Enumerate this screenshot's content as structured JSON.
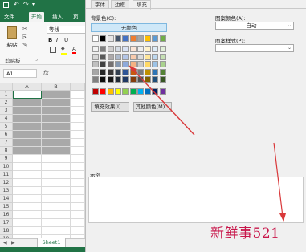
{
  "excel": {
    "tabs": [
      "文件",
      "开始",
      "插入",
      "页"
    ],
    "clipboard": {
      "paste_label": "粘贴",
      "group_label": "剪贴板"
    },
    "font": {
      "name": "等线",
      "bold": "B",
      "italic": "I",
      "underline": "U"
    },
    "namebox": "A1",
    "columns": [
      "A",
      "B"
    ],
    "rows": [
      "1",
      "2",
      "3",
      "4",
      "5",
      "6",
      "7",
      "8",
      "9",
      "10",
      "11",
      "12",
      "13",
      "14",
      "15",
      "16",
      "17",
      "18",
      "19"
    ],
    "sheet_tab": "Sheet1"
  },
  "dialog": {
    "tabs": [
      "字体",
      "边框",
      "填充"
    ],
    "bg_color_label": "背景色(C):",
    "no_color": "无颜色",
    "fill_effects_button": "填充效果(I)...",
    "more_colors_button": "其他颜色(M)...",
    "pattern_color_label": "图案颜色(A):",
    "pattern_color_value": "自动",
    "pattern_style_label": "图案样式(P):",
    "sample_label": "示例"
  },
  "watermark": "新鲜事521",
  "colors": {
    "excel_green": "#217346",
    "selection": "#a9a9a9",
    "arrow": "#d9383a"
  },
  "palette": {
    "theme_row": [
      "#ffffff",
      "#000000",
      "#e7e6e6",
      "#44546a",
      "#4472c4",
      "#ed7d31",
      "#a5a5a5",
      "#ffc000",
      "#5b9bd5",
      "#70ad47"
    ],
    "shades": [
      [
        "#f2f2f2",
        "#7f7f7f",
        "#d0cece",
        "#d6dce4",
        "#d9e2f3",
        "#fbe5d6",
        "#ededed",
        "#fff2cc",
        "#ddebf7",
        "#e2efda"
      ],
      [
        "#d9d9d9",
        "#595959",
        "#aeaaaa",
        "#adb9ca",
        "#b4c6e7",
        "#f8cbad",
        "#dbdbdb",
        "#ffe699",
        "#bdd7ee",
        "#c6e0b4"
      ],
      [
        "#bfbfbf",
        "#404040",
        "#757171",
        "#8497b0",
        "#8eaadb",
        "#f4b183",
        "#c9c9c9",
        "#ffd966",
        "#9dc3e6",
        "#a9d18e"
      ],
      [
        "#a6a6a6",
        "#262626",
        "#3a3838",
        "#333f4f",
        "#2f5597",
        "#c55a11",
        "#7b7b7b",
        "#bf9000",
        "#2e75b6",
        "#548235"
      ],
      [
        "#808080",
        "#0d0d0d",
        "#171616",
        "#222a35",
        "#1f3864",
        "#843c0c",
        "#525252",
        "#7f6000",
        "#1f4e79",
        "#375623"
      ]
    ],
    "standard": [
      "#c00000",
      "#ff0000",
      "#ffc000",
      "#ffff00",
      "#92d050",
      "#00b050",
      "#00b0f0",
      "#0070c0",
      "#002060",
      "#7030a0"
    ]
  }
}
